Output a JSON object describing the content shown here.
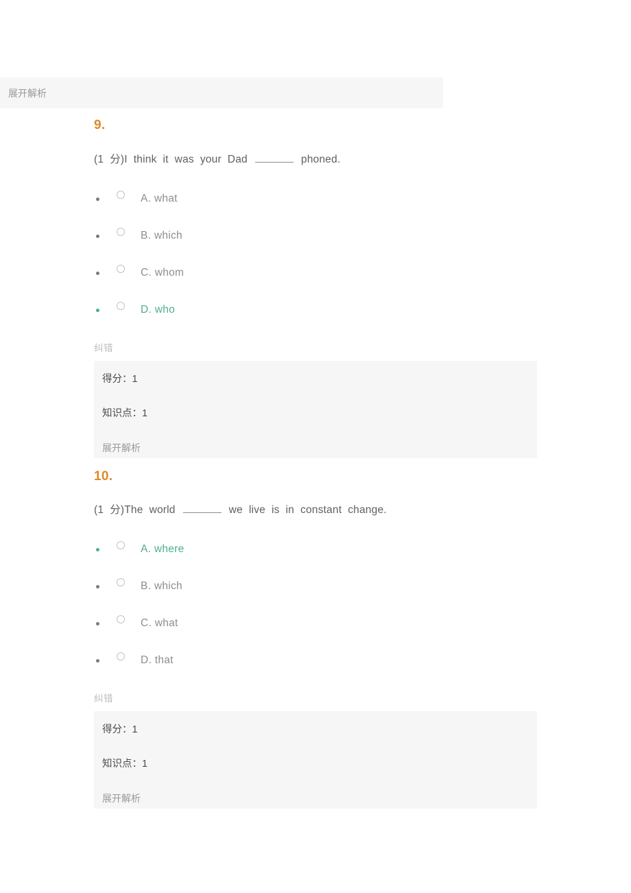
{
  "page": {
    "background": "#ffffff",
    "accent_orange": "#dd8a2a",
    "accent_green": "#4fae87",
    "panel_gray": "#f6f6f6"
  },
  "top_partial_box": {
    "expand_label": "展开解析"
  },
  "questions": [
    {
      "number": "9.",
      "score_prefix": "(1 分)",
      "stem_before": "I think it was your Dad",
      "stem_after": "phoned.",
      "options": [
        {
          "label": "A. what",
          "correct": false,
          "selected": false
        },
        {
          "label": "B. which",
          "correct": false,
          "selected": false
        },
        {
          "label": "C. whom",
          "correct": false,
          "selected": false
        },
        {
          "label": "D. who",
          "correct": true,
          "selected": false
        }
      ],
      "report_label": "纠错",
      "result": {
        "score_label": "得分：",
        "score_value": "1",
        "knowledge_label": "知识点：",
        "knowledge_value": "1",
        "expand_label": "展开解析"
      }
    },
    {
      "number": "10.",
      "score_prefix": "(1 分)",
      "stem_before": "The world",
      "stem_after": "we live is in constant change.",
      "options": [
        {
          "label": "A. where",
          "correct": true,
          "selected": false
        },
        {
          "label": "B. which",
          "correct": false,
          "selected": false
        },
        {
          "label": "C. what",
          "correct": false,
          "selected": false
        },
        {
          "label": "D. that",
          "correct": false,
          "selected": false
        }
      ],
      "report_label": "纠错",
      "result": {
        "score_label": "得分：",
        "score_value": "1",
        "knowledge_label": "知识点：",
        "knowledge_value": "1",
        "expand_label": "展开解析"
      }
    }
  ]
}
